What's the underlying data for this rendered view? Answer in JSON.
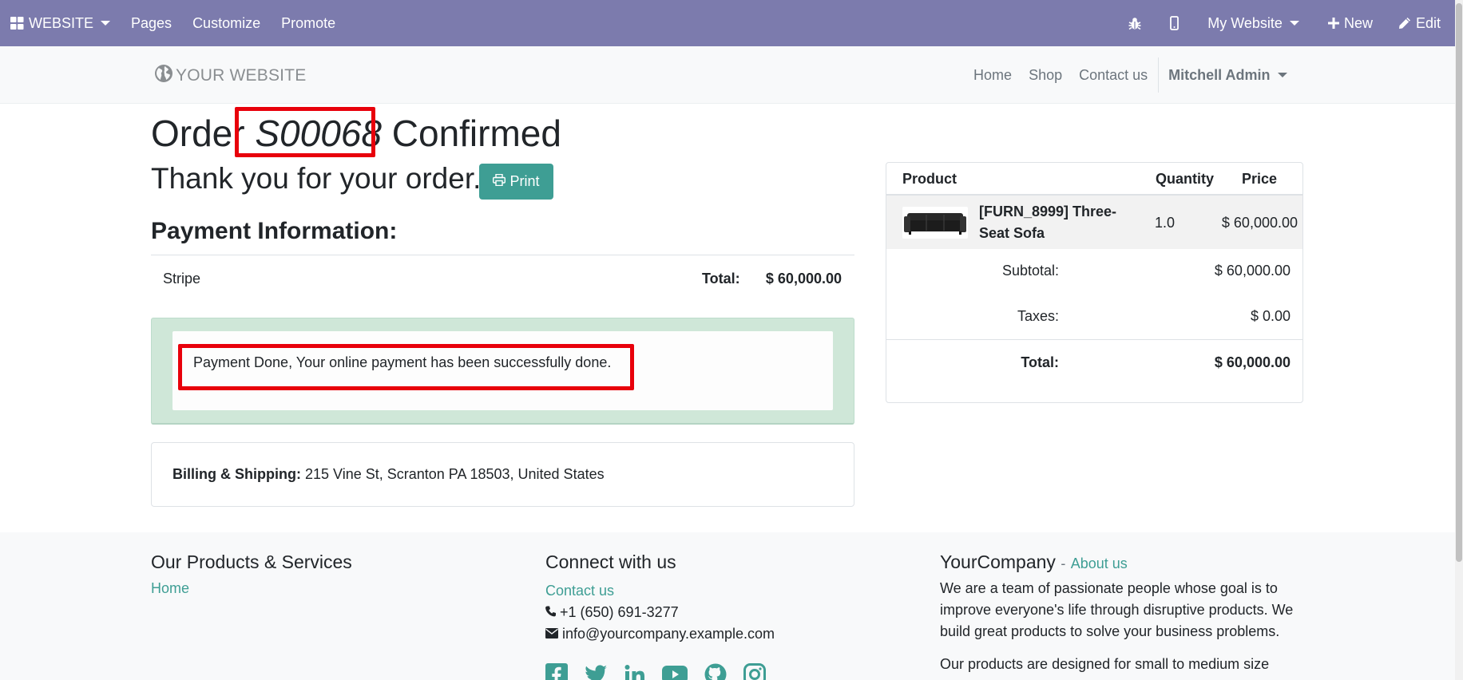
{
  "admin_bar": {
    "brand": "WEBSITE",
    "menu": [
      "Pages",
      "Customize",
      "Promote"
    ],
    "icons": [
      "bug-icon",
      "mobile-icon"
    ],
    "website_switcher": "My Website",
    "new_label": "New",
    "edit_label": "Edit",
    "background_color": "#7c7bad"
  },
  "header": {
    "logo_text": "YOUR WEBSITE",
    "nav": [
      "Home",
      "Shop",
      "Contact us"
    ],
    "user": "Mitchell Admin"
  },
  "order": {
    "title_prefix": "Order",
    "reference": "S00068",
    "title_suffix": "Confirmed",
    "thanks": "Thank you for your order.",
    "print_label": "Print",
    "payment_heading": "Payment Information:",
    "provider": "Stripe",
    "total_label": "Total:",
    "total_value": "$ 60,000.00",
    "payment_message": "Payment Done, Your online payment has been successfully done.",
    "billing_label": "Billing & Shipping:",
    "billing_address": "215 Vine St, Scranton PA 18503, United States"
  },
  "summary": {
    "columns": [
      "Product",
      "Quantity",
      "Price"
    ],
    "product": {
      "name": "[FURN_8999] Three-Seat Sofa",
      "quantity": "1.0",
      "price": "$ 60,000.00"
    },
    "subtotal_label": "Subtotal:",
    "subtotal_value": "$ 60,000.00",
    "taxes_label": "Taxes:",
    "taxes_value": "$ 0.00",
    "total_label": "Total:",
    "total_value": "$ 60,000.00"
  },
  "footer": {
    "col1_title": "Our Products & Services",
    "col1_link": "Home",
    "col2_title": "Connect with us",
    "col2_link": "Contact us",
    "phone": "+1 (650) 691-3277",
    "email": "info@yourcompany.example.com",
    "social": [
      "facebook-icon",
      "twitter-icon",
      "linkedin-icon",
      "youtube-icon",
      "github-icon",
      "instagram-icon"
    ],
    "col3_title": "YourCompany",
    "col3_sep": "-",
    "col3_link": "About us",
    "about_text": "We are a team of passionate people whose goal is to improve everyone's life through disruptive products. We build great products to solve your business problems.",
    "about_text2": "Our products are designed for small to medium size"
  },
  "colors": {
    "accent": "#3e9e94",
    "highlight_box": "#e8000b",
    "success_bg": "#cfe7d8"
  }
}
